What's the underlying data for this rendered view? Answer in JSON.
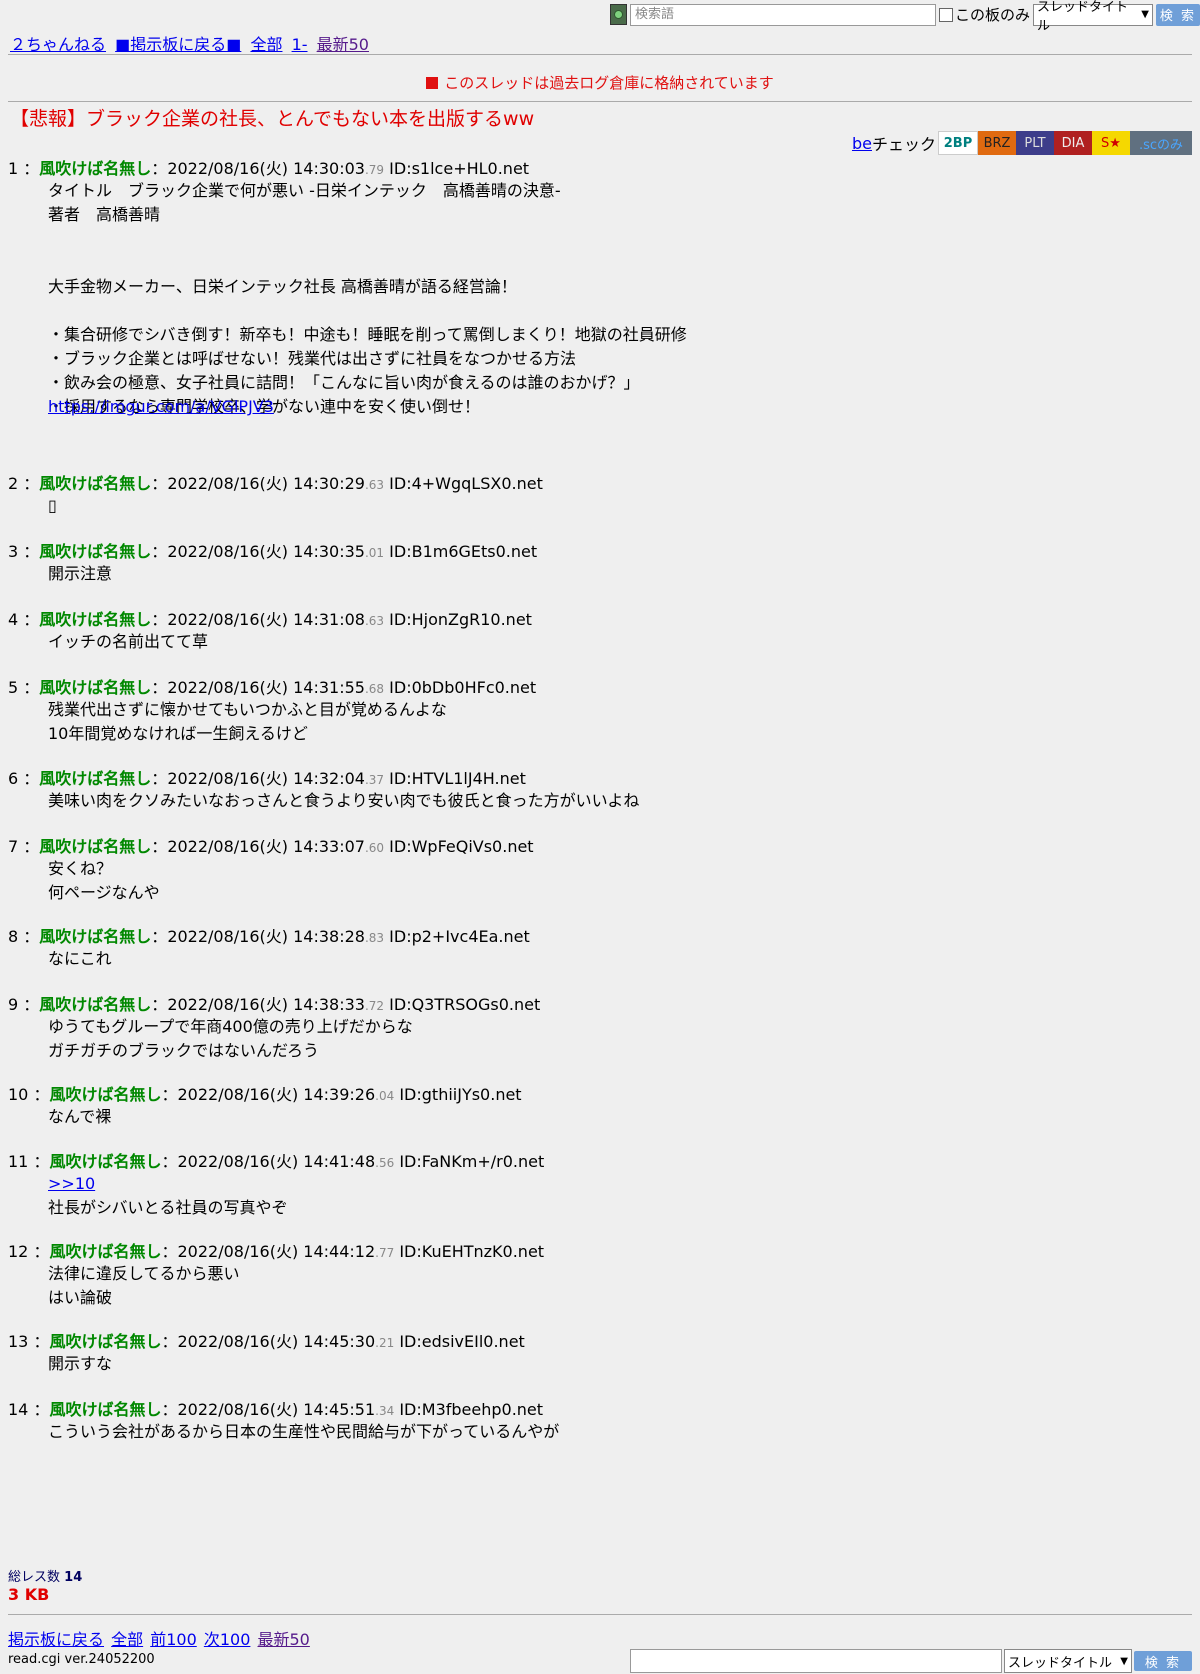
{
  "search": {
    "placeholder": "検索語",
    "board_only": "この板のみ",
    "scope": "スレッドタイトル",
    "button": "検 索"
  },
  "nav": {
    "site": "２ちゃんねる",
    "back": "■掲示板に戻る■",
    "all": "全部",
    "first": "1-",
    "latest": "最新50"
  },
  "notice": "このスレッドは過去ログ倉庫に格納されています",
  "thread_title": "【悲報】ブラック企業の社長、とんでもない本を出版するww",
  "becheck": {
    "be": "be",
    "label": "チェック",
    "badges": [
      "2BP",
      "BRZ",
      "PLT",
      "DIA",
      "S★",
      ".scのみ"
    ]
  },
  "posts": [
    {
      "num": "1",
      "name": "風吹けば名無し",
      "date": "2022/08/16(火) 14:30:03",
      "ms": ".79",
      "id": "ID:s1lce+HL0.net",
      "body": "タイトル　ブラック企業で何が悪い -日栄インテック　高橋善晴の決意-\n著者　高橋善晴\n\n\n大手金物メーカー、日栄インテック社長 高橋善晴が語る経営論！\n\n・集合研修でシバき倒す！新卒も！中途も！睡眠を削って罵倒しまくり！地獄の社員研修\n・ブラック企業とは呼ばせない！残業代は出さずに社員をなつかせる方法\n・飲み会の極意、女子社員に詰問！「こんなに旨い肉が食えるのは誰のおかげ？」\n・採用するなら専門学校卒、学がない連中を安く使い倒せ！\n",
      "link": "https://imgur.com/a/VGlPJV3"
    },
    {
      "num": "2",
      "name": "風吹けば名無し",
      "date": "2022/08/16(火) 14:30:29",
      "ms": ".63",
      "id": "ID:4+WgqLSX0.net",
      "body": "▯"
    },
    {
      "num": "3",
      "name": "風吹けば名無し",
      "date": "2022/08/16(火) 14:30:35",
      "ms": ".01",
      "id": "ID:B1m6GEts0.net",
      "body": "開示注意"
    },
    {
      "num": "4",
      "name": "風吹けば名無し",
      "date": "2022/08/16(火) 14:31:08",
      "ms": ".63",
      "id": "ID:HjonZgR10.net",
      "body": "イッチの名前出てて草"
    },
    {
      "num": "5",
      "name": "風吹けば名無し",
      "date": "2022/08/16(火) 14:31:55",
      "ms": ".68",
      "id": "ID:0bDb0HFc0.net",
      "body": "残業代出さずに懐かせてもいつかふと目が覚めるんよな\n10年間覚めなければ一生飼えるけど"
    },
    {
      "num": "6",
      "name": "風吹けば名無し",
      "date": "2022/08/16(火) 14:32:04",
      "ms": ".37",
      "id": "ID:HTVL1lJ4H.net",
      "body": "美味い肉をクソみたいなおっさんと食うより安い肉でも彼氏と食った方がいいよね"
    },
    {
      "num": "7",
      "name": "風吹けば名無し",
      "date": "2022/08/16(火) 14:33:07",
      "ms": ".60",
      "id": "ID:WpFeQiVs0.net",
      "body": "安くね？\n何ページなんや"
    },
    {
      "num": "8",
      "name": "風吹けば名無し",
      "date": "2022/08/16(火) 14:38:28",
      "ms": ".83",
      "id": "ID:p2+Ivc4Ea.net",
      "body": "なにこれ"
    },
    {
      "num": "9",
      "name": "風吹けば名無し",
      "date": "2022/08/16(火) 14:38:33",
      "ms": ".72",
      "id": "ID:Q3TRSOGs0.net",
      "body": "ゆうてもグループで年商400億の売り上げだからな\nガチガチのブラックではないんだろう"
    },
    {
      "num": "10",
      "name": "風吹けば名無し",
      "date": "2022/08/16(火) 14:39:26",
      "ms": ".04",
      "id": "ID:gthiiJYs0.net",
      "body": "なんで裸"
    },
    {
      "num": "11",
      "name": "風吹けば名無し",
      "date": "2022/08/16(火) 14:41:48",
      "ms": ".56",
      "id": "ID:FaNKm+/r0.net",
      "anchor": ">>10",
      "body": "社長がシバいとる社員の写真やぞ"
    },
    {
      "num": "12",
      "name": "風吹けば名無し",
      "date": "2022/08/16(火) 14:44:12",
      "ms": ".77",
      "id": "ID:KuEHTnzK0.net",
      "body": "法律に違反してるから悪い\nはい論破"
    },
    {
      "num": "13",
      "name": "風吹けば名無し",
      "date": "2022/08/16(火) 14:45:30",
      "ms": ".21",
      "id": "ID:edsivEIl0.net",
      "body": "開示すな"
    },
    {
      "num": "14",
      "name": "風吹けば名無し",
      "date": "2022/08/16(火) 14:45:51",
      "ms": ".34",
      "id": "ID:M3fbeehp0.net",
      "body": "こういう会社があるから日本の生産性や民間給与が下がっているんやが"
    }
  ],
  "footer": {
    "total_label": "総レス数",
    "total": "14",
    "size": "3 KB",
    "back": "掲示板に戻る",
    "all": "全部",
    "prev": "前100",
    "next": "次100",
    "latest": "最新50",
    "version": "read.cgi ver.24052200"
  },
  "colors": {
    "background": "#efefef",
    "name_green": "#008800",
    "notice_red": "#e01010",
    "link_blue": "#0000ee",
    "search_button": "#6f9fd8"
  }
}
